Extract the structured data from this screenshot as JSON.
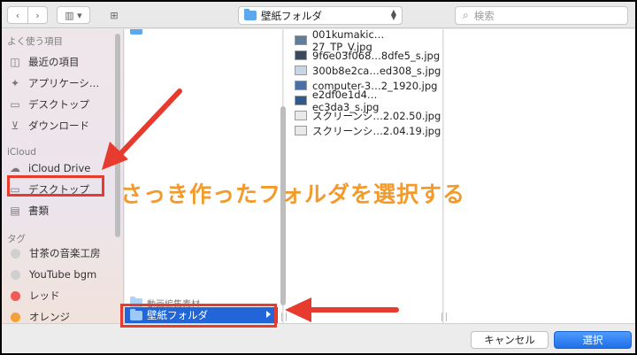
{
  "toolbar": {
    "path_label": "壁紙フォルダ",
    "search_placeholder": "検索"
  },
  "sidebar": {
    "favorites_header": "よく使う項目",
    "favorites": [
      {
        "label": "最近の項目",
        "icon": "clock-icon"
      },
      {
        "label": "アプリケーシ…",
        "icon": "applications-icon"
      },
      {
        "label": "デスクトップ",
        "icon": "desktop-icon"
      },
      {
        "label": "ダウンロード",
        "icon": "download-icon"
      }
    ],
    "icloud_header": "iCloud",
    "icloud": [
      {
        "label": "iCloud Drive",
        "icon": "cloud-icon"
      },
      {
        "label": "デスクトップ",
        "icon": "desktop-icon"
      },
      {
        "label": "書類",
        "icon": "document-icon"
      }
    ],
    "tags_header": "タグ",
    "tags": [
      {
        "label": "甘茶の音楽工房",
        "color": "#d0d0d0"
      },
      {
        "label": "YouTube bgm",
        "color": "#d0d0d0"
      },
      {
        "label": "レッド",
        "color": "#ef5b56"
      },
      {
        "label": "オレンジ",
        "color": "#f4a13b"
      }
    ]
  },
  "column1": {
    "faint_item": "動画編集素材",
    "selected_item": "壁紙フォルダ"
  },
  "column2": {
    "files": [
      {
        "name": "001kumakic…27_TP_V.jpg",
        "thumb": "#5d7f9e"
      },
      {
        "name": "9f6e03f068…8dfe5_s.jpg",
        "thumb": "#3b4a5a"
      },
      {
        "name": "300b8e2ca…ed308_s.jpg",
        "thumb": "#c7d6e6"
      },
      {
        "name": "computer-3…2_1920.jpg",
        "thumb": "#4d6fa8"
      },
      {
        "name": "e2df0e1d4…ec3da3_s.jpg",
        "thumb": "#2f5b8c"
      },
      {
        "name": "スクリーンシ…2.02.50.jpg",
        "thumb": "#e9e9e9"
      },
      {
        "name": "スクリーンシ…2.04.19.jpg",
        "thumb": "#e9e9e9"
      }
    ]
  },
  "footer": {
    "cancel_label": "キャンセル",
    "select_label": "選択"
  },
  "annotation": {
    "text": "さっき作ったフォルダを選択する",
    "color": "#f39a2b",
    "arrow_color": "#e63b2e"
  }
}
